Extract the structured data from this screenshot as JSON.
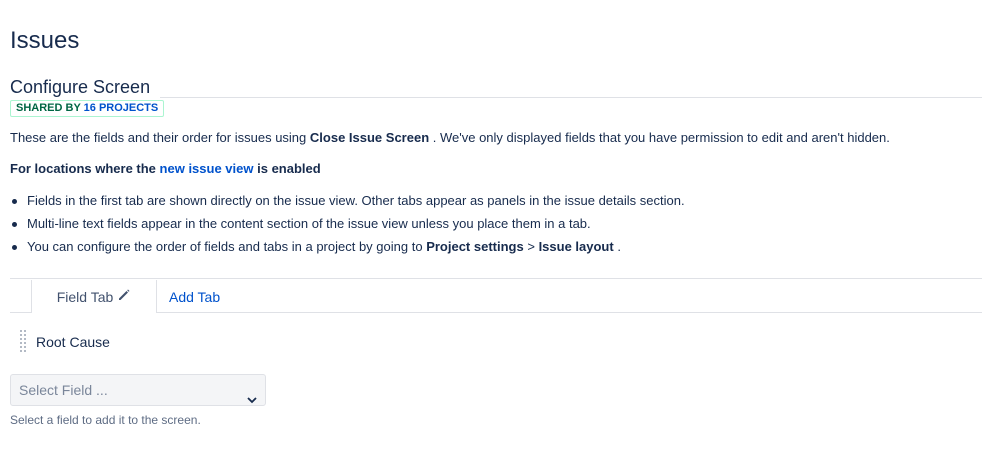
{
  "page": {
    "title": "Issues"
  },
  "screen": {
    "title": "Configure Screen",
    "badge": {
      "prefix": "SHARED BY",
      "count": "16 PROJECTS"
    },
    "description": {
      "before": "These are the fields and their order for issues using",
      "screen_name": "Close Issue Screen",
      "after": ". We've only displayed fields that you have permission to edit and aren't hidden."
    },
    "subheading": {
      "before": "For locations where the",
      "link": "new issue view",
      "after": "is enabled"
    },
    "bullets": [
      {
        "text": "Fields in the first tab are shown directly on the issue view. Other tabs appear as panels in the issue details section."
      },
      {
        "text": "Multi-line text fields appear in the content section of the issue view unless you place them in a tab."
      },
      {
        "before": "You can configure the order of fields and tabs in a project by going to",
        "bold1": "Project settings",
        "sep": ">",
        "bold2": "Issue layout",
        "after": "."
      }
    ]
  },
  "tabs": {
    "active_label": "Field Tab",
    "add_label": "Add Tab"
  },
  "fields": [
    {
      "name": "Root Cause"
    }
  ],
  "select": {
    "placeholder": "Select Field ...",
    "help": "Select a field to add it to the screen."
  },
  "icons": {
    "edit": "pencil-icon",
    "drag": "drag-handle-icon",
    "dropdown": "chevron-down-icon"
  },
  "colors": {
    "link": "#0052cc",
    "text": "#172b4d",
    "badge_green": "#006644"
  }
}
